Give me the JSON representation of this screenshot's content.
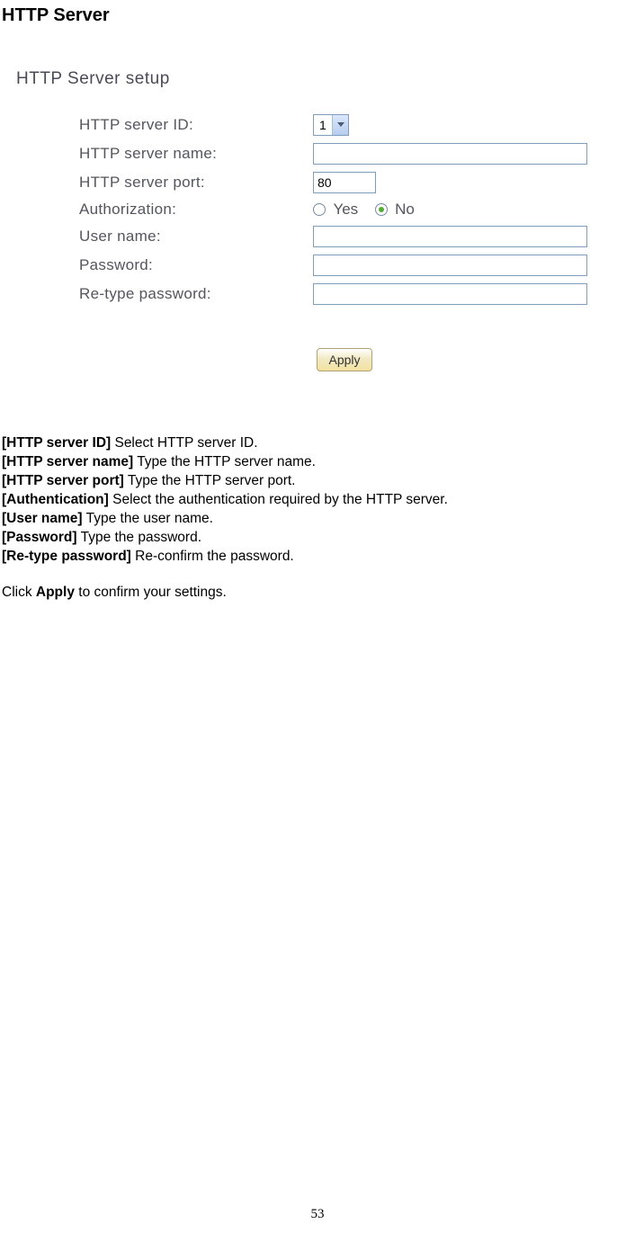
{
  "heading": "HTTP Server",
  "setup_title": "HTTP Server setup",
  "form": {
    "server_id_label": "HTTP server ID:",
    "server_id_value": "1",
    "server_name_label": "HTTP server name:",
    "server_name_value": "",
    "server_port_label": "HTTP server port:",
    "server_port_value": "80",
    "auth_label": "Authorization:",
    "auth_yes": "Yes",
    "auth_no": "No",
    "user_name_label": "User name:",
    "user_name_value": "",
    "password_label": "Password:",
    "password_value": "",
    "retype_label": "Re-type password:",
    "retype_value": "",
    "apply_label": "Apply"
  },
  "desc": {
    "l1b": "[HTTP server ID]",
    "l1t": " Select HTTP server ID.",
    "l2b": "[HTTP server name]",
    "l2t": " Type the HTTP server name.",
    "l3b": "[HTTP server port]",
    "l3t": " Type the HTTP server port.",
    "l4b": "[Authentication]",
    "l4t": " Select the authentication required by the HTTP server.",
    "l5b": "[User name]",
    "l5t": " Type the user name.",
    "l6b": "[Password]",
    "l6t": " Type the password.",
    "l7b": "[Re-type password]",
    "l7t": " Re-confirm the password.",
    "click1": "Click ",
    "click_apply": "Apply",
    "click2": " to confirm your settings."
  },
  "page_number": "53"
}
